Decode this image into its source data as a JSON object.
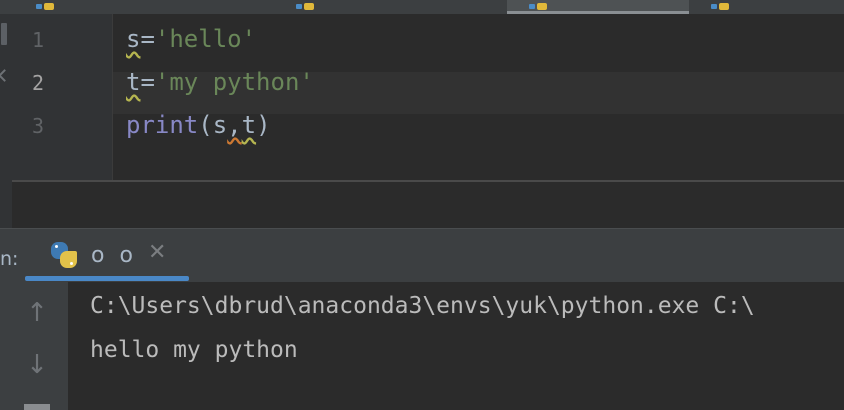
{
  "editor": {
    "lines": [
      {
        "number": "1",
        "var": "s",
        "op": "=",
        "value": "'hello'"
      },
      {
        "number": "2",
        "var": "t",
        "op": "=",
        "value": "'my python'"
      },
      {
        "number": "3",
        "func": "print",
        "open": "(",
        "arg1": "s",
        "comma": ",",
        "arg2": "t",
        "close": ")"
      }
    ]
  },
  "run_panel": {
    "label": "n:",
    "tab_title": "o o",
    "close_symbol": "✕",
    "up_arrow": "↑",
    "down_arrow": "↓",
    "output": [
      "C:\\Users\\dbrud\\anaconda3\\envs\\yuk\\python.exe C:\\",
      "hello my python"
    ]
  },
  "colors": {
    "background": "#2b2b2b",
    "string": "#6a8759",
    "builtin": "#8888c6",
    "default_text": "#a9b7c6",
    "accent": "#4a88c7"
  }
}
